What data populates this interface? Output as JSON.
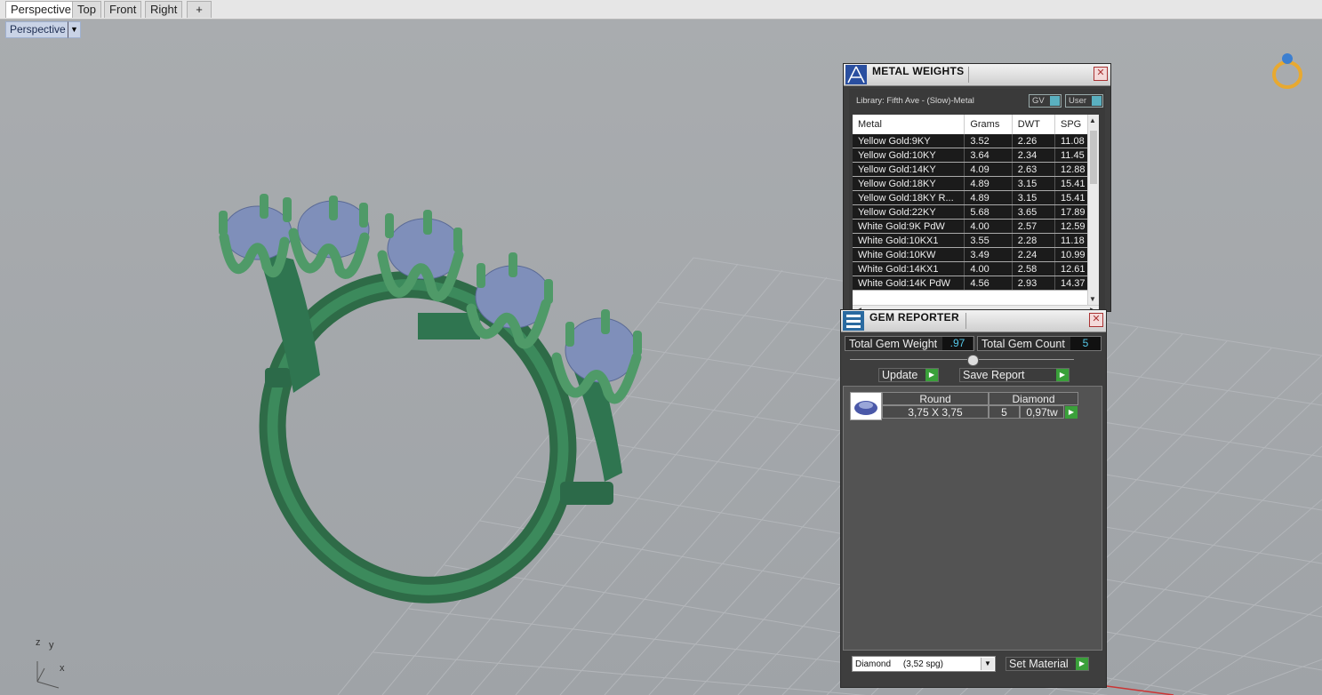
{
  "tabs": [
    {
      "label": "Perspective",
      "active": true
    },
    {
      "label": "Top",
      "active": false
    },
    {
      "label": "Front",
      "active": false
    },
    {
      "label": "Right",
      "active": false
    },
    {
      "label": "+",
      "active": false
    }
  ],
  "viewport": {
    "label": "Perspective",
    "axes": {
      "x": "x",
      "y": "y",
      "z": "z"
    }
  },
  "metal_weights": {
    "title": "METAL WEIGHTS",
    "library": "Library: Fifth Ave - (Slow)-Metal",
    "gv_label": "GV",
    "user_label": "User",
    "columns": [
      "Metal",
      "Grams",
      "DWT",
      "SPG"
    ],
    "rows": [
      [
        "Yellow Gold:9KY",
        "3.52",
        "2.26",
        "11.08"
      ],
      [
        "Yellow Gold:10KY",
        "3.64",
        "2.34",
        "11.45"
      ],
      [
        "Yellow Gold:14KY",
        "4.09",
        "2.63",
        "12.88"
      ],
      [
        "Yellow Gold:18KY",
        "4.89",
        "3.15",
        "15.41"
      ],
      [
        "Yellow Gold:18KY R...",
        "4.89",
        "3.15",
        "15.41"
      ],
      [
        "Yellow Gold:22KY",
        "5.68",
        "3.65",
        "17.89"
      ],
      [
        "White Gold:9K PdW",
        "4.00",
        "2.57",
        "12.59"
      ],
      [
        "White Gold:10KX1",
        "3.55",
        "2.28",
        "11.18"
      ],
      [
        "White Gold:10KW",
        "3.49",
        "2.24",
        "10.99"
      ],
      [
        "White Gold:14KX1",
        "4.00",
        "2.58",
        "12.61"
      ],
      [
        "White Gold:14K PdW",
        "4.56",
        "2.93",
        "14.37"
      ]
    ]
  },
  "gem_reporter": {
    "title": "GEM REPORTER",
    "total_weight_label": "Total Gem Weight",
    "total_weight_value": ".97",
    "total_count_label": "Total Gem Count",
    "total_count_value": "5",
    "update_label": "Update",
    "save_report_label": "Save Report",
    "gems": [
      {
        "shape": "Round",
        "material": "Diamond",
        "size": "3,75 X 3,75",
        "count": "5",
        "weight": "0,97tw"
      }
    ],
    "material_select": "Diamond     (3,52 spg)",
    "set_material_label": "Set Material"
  }
}
